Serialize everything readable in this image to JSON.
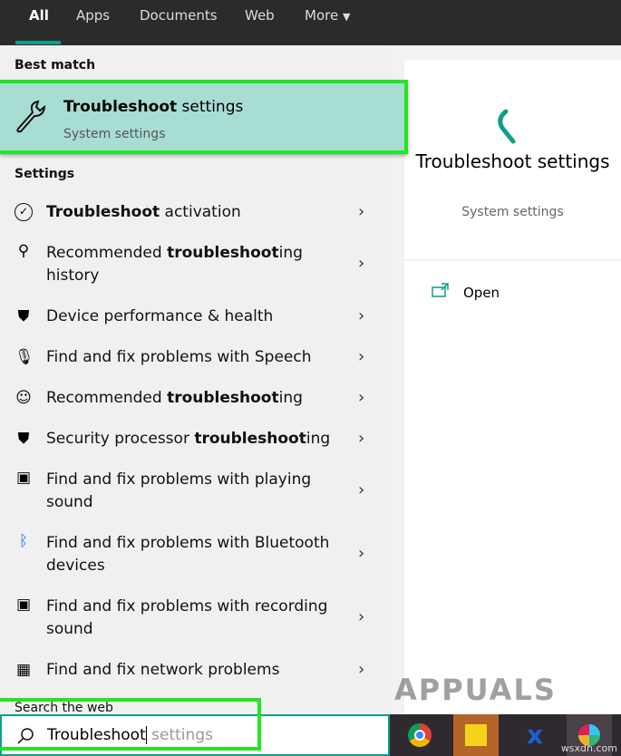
{
  "tabs": [
    {
      "label": "All",
      "active": true
    },
    {
      "label": "Apps"
    },
    {
      "label": "Documents"
    },
    {
      "label": "Web"
    },
    {
      "label": "More"
    }
  ],
  "best_match": {
    "header": "Best match",
    "title_bold": "Troubleshoot",
    "title_rest": " settings",
    "subtitle": "System settings",
    "icon": "wrench-icon"
  },
  "settings_header": "Settings",
  "items": [
    {
      "pre": "",
      "bold": "Troubleshoot",
      "post": " activation",
      "icon": "check-circle-icon"
    },
    {
      "pre": "Recommended ",
      "bold": "troubleshoot",
      "post": "ing history",
      "icon": "wrench-icon"
    },
    {
      "pre": "Device performance & health",
      "bold": "",
      "post": "",
      "icon": "shield-icon"
    },
    {
      "pre": "Find and fix problems with Speech",
      "bold": "",
      "post": "",
      "icon": "microphone-icon"
    },
    {
      "pre": "Recommended ",
      "bold": "troubleshoot",
      "post": "ing",
      "icon": "person-chat-icon"
    },
    {
      "pre": "Security processor ",
      "bold": "troubleshoot",
      "post": "ing",
      "icon": "shield-icon"
    },
    {
      "pre": "Find and fix problems with playing sound",
      "bold": "",
      "post": "",
      "icon": "speaker-icon"
    },
    {
      "pre": "Find and fix problems with Bluetooth devices",
      "bold": "",
      "post": "",
      "icon": "bluetooth-icon"
    },
    {
      "pre": "Find and fix problems with recording sound",
      "bold": "",
      "post": "",
      "icon": "recorder-icon"
    },
    {
      "pre": "Find and fix network problems",
      "bold": "",
      "post": "",
      "icon": "network-icon"
    }
  ],
  "preview": {
    "title": "Troubleshoot settings",
    "subtitle": "System settings",
    "open_label": "Open"
  },
  "search_web_header": "Search the web",
  "search": {
    "typed": "Troubleshoot",
    "suggestion": " settings"
  },
  "watermark": "APPUALS",
  "taskbar": [
    "chrome-icon",
    "sticky-notes-icon",
    "app-x-icon",
    "slack-icon"
  ],
  "site": "wsxdn.com",
  "colors": {
    "accent": "#0e9f8a",
    "highlight": "#22e61e",
    "selected": "#a8ddd4"
  }
}
